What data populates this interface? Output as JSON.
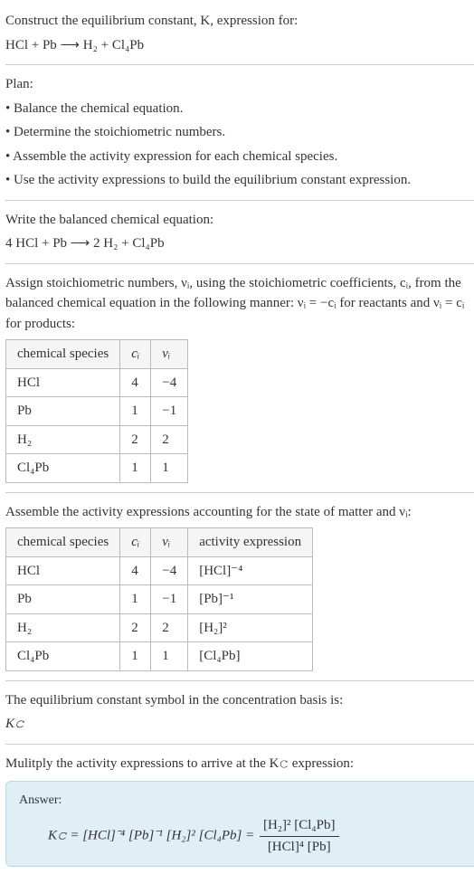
{
  "intro": {
    "line1": "Construct the equilibrium constant, K, expression for:",
    "reaction_unbalanced": "HCl + Pb  ⟶  H₂ + Cl₄Pb"
  },
  "plan": {
    "heading": "Plan:",
    "items": [
      "• Balance the chemical equation.",
      "• Determine the stoichiometric numbers.",
      "• Assemble the activity expression for each chemical species.",
      "• Use the activity expressions to build the equilibrium constant expression."
    ]
  },
  "balanced": {
    "prompt": "Write the balanced chemical equation:",
    "reaction": "4 HCl + Pb  ⟶  2 H₂ + Cl₄Pb"
  },
  "assign": {
    "text": "Assign stoichiometric numbers, νᵢ, using the stoichiometric coefficients, cᵢ, from the balanced chemical equation in the following manner: νᵢ = −cᵢ for reactants and νᵢ = cᵢ for products:"
  },
  "table1": {
    "headers": {
      "species": "chemical species",
      "ci": "cᵢ",
      "vi": "νᵢ"
    },
    "rows": [
      {
        "species": "HCl",
        "ci": "4",
        "vi": "−4"
      },
      {
        "species": "Pb",
        "ci": "1",
        "vi": "−1"
      },
      {
        "species": "H₂",
        "ci": "2",
        "vi": "2"
      },
      {
        "species": "Cl₄Pb",
        "ci": "1",
        "vi": "1"
      }
    ]
  },
  "assemble_text": "Assemble the activity expressions accounting for the state of matter and νᵢ:",
  "table2": {
    "headers": {
      "species": "chemical species",
      "ci": "cᵢ",
      "vi": "νᵢ",
      "act": "activity expression"
    },
    "rows": [
      {
        "species": "HCl",
        "ci": "4",
        "vi": "−4",
        "act": "[HCl]⁻⁴"
      },
      {
        "species": "Pb",
        "ci": "1",
        "vi": "−1",
        "act": "[Pb]⁻¹"
      },
      {
        "species": "H₂",
        "ci": "2",
        "vi": "2",
        "act": "[H₂]²"
      },
      {
        "species": "Cl₄Pb",
        "ci": "1",
        "vi": "1",
        "act": "[Cl₄Pb]"
      }
    ]
  },
  "kc_basis": {
    "line": "The equilibrium constant symbol in the concentration basis is:",
    "symbol": "K𝚌"
  },
  "multiply": "Mulitply the activity expressions to arrive at the K𝚌 expression:",
  "answer": {
    "label": "Answer:",
    "lhs": "K𝚌 = [HCl]⁻⁴ [Pb]⁻¹ [H₂]² [Cl₄Pb] = ",
    "frac_num": "[H₂]² [Cl₄Pb]",
    "frac_den": "[HCl]⁴ [Pb]"
  }
}
